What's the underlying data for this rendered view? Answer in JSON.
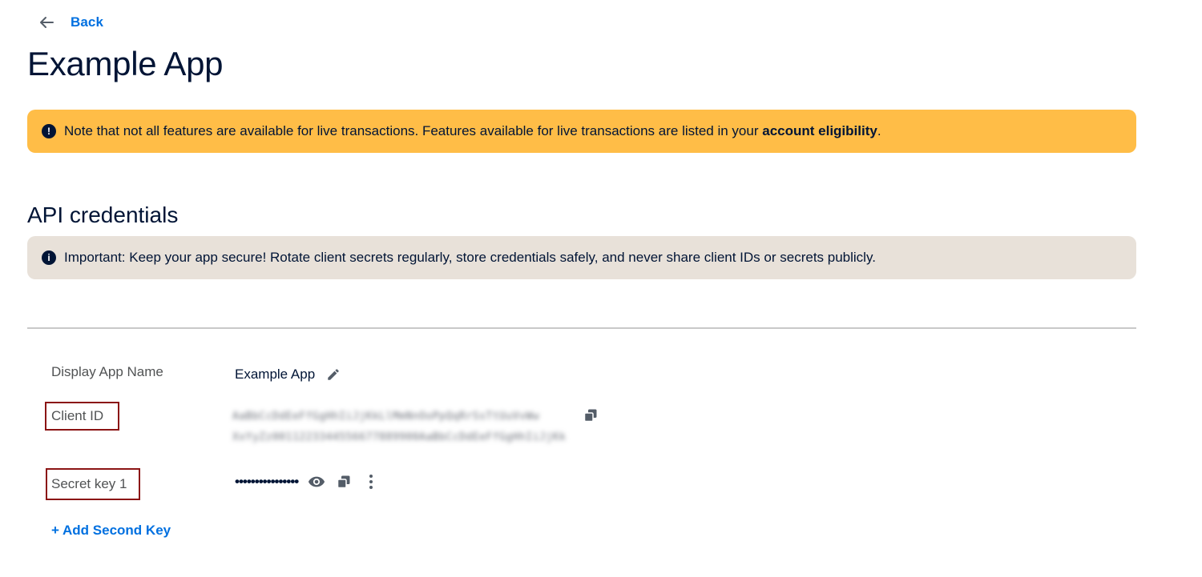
{
  "nav": {
    "back_label": "Back"
  },
  "page": {
    "title": "Example App"
  },
  "warning_banner": {
    "icon": "exclamation-icon",
    "text_prefix": "Note that not all features are available for live transactions. Features available for live transactions are listed in your ",
    "link_text": "account eligibility",
    "text_suffix": ".",
    "color": "#ffbd47"
  },
  "section": {
    "title": "API credentials"
  },
  "info_banner": {
    "icon": "info-icon",
    "text": "Important: Keep your app secure! Rotate client secrets regularly, store credentials safely, and never share client IDs or secrets publicly.",
    "color": "#e8e1d9"
  },
  "credentials": {
    "app_name_label": "Display App Name",
    "app_name_value": "Example App",
    "client_id_label": "Client ID",
    "client_id_line1": "AaBbCcDdEeFfGgHhIiJjKkLlMmNnOoPpQqRrSsTtUuVvWw",
    "client_id_line2": "XxYyZz0011223344556677889900AaBbCcDdEeFfGgHhIiJjKk",
    "secret_label": "Secret key 1",
    "secret_value": "••••••••••••••••"
  },
  "actions": {
    "add_second_key": "+ Add Second Key"
  },
  "colors": {
    "link": "#0070e0",
    "text_primary": "#001435",
    "highlight_border": "#8b1414"
  }
}
